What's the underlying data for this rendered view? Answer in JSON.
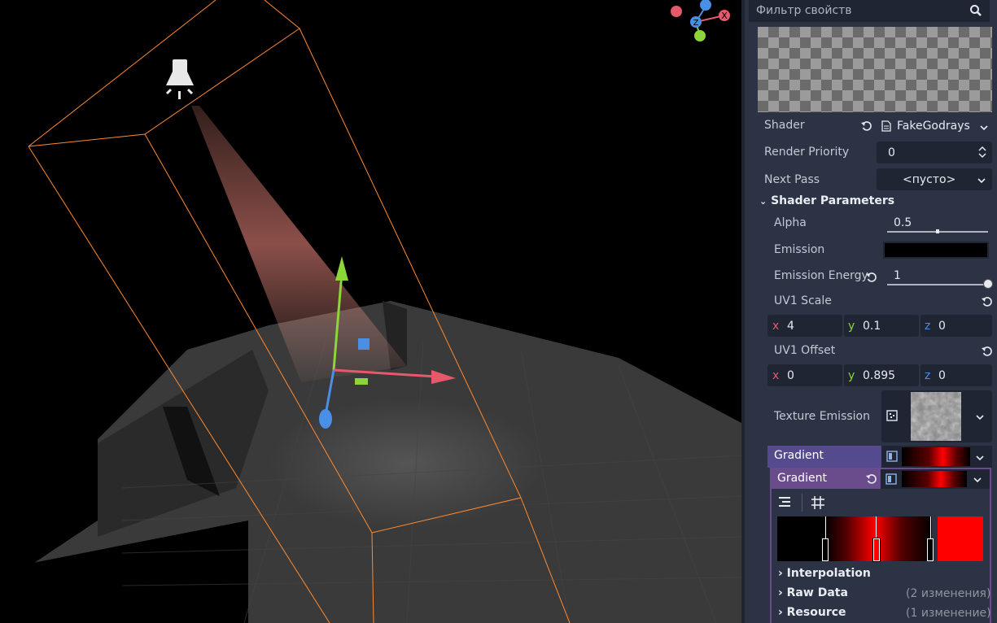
{
  "filter": {
    "placeholder": "Фильтр свойств",
    "icon": "search-icon"
  },
  "gizmo": {
    "x": "X",
    "y": "Y",
    "z": "Z"
  },
  "props": {
    "shader_label": "Shader",
    "shader_value": "FakeGodrays",
    "render_priority_label": "Render Priority",
    "render_priority_value": "0",
    "next_pass_label": "Next Pass",
    "next_pass_value": "<пусто>"
  },
  "shader_params": {
    "header": "Shader Parameters",
    "alpha_label": "Alpha",
    "alpha_value": "0.5",
    "alpha_level": 0.5,
    "emission_label": "Emission",
    "emission_color": "#000000",
    "emission_energy_label": "Emission Energy",
    "emission_energy_value": "1",
    "emission_energy_level": 1.0,
    "uv1_scale_label": "UV1 Scale",
    "uv1_scale": {
      "x_label": "x",
      "x": "4",
      "y_label": "y",
      "y": "0.1",
      "z_label": "z",
      "z": "0"
    },
    "uv1_offset_label": "UV1 Offset",
    "uv1_offset": {
      "x_label": "x",
      "x": "0",
      "y_label": "y",
      "y": "0.895",
      "z_label": "z",
      "z": "0"
    },
    "texture_emission_label": "Texture Emission"
  },
  "gradient": {
    "outer_label": "Gradient",
    "inner_label": "Gradient",
    "interpolation_label": "Interpolation",
    "raw_data_label": "Raw Data",
    "raw_data_hint": "(2 изменения)",
    "resource_label": "Resource",
    "resource_hint": "(1 изменение)",
    "selected_color": "#ff0000"
  },
  "colors": {
    "panel_bg": "#2c3345",
    "field_bg": "#1f2533",
    "axis_x": "#e6596b",
    "axis_y": "#8dd63a",
    "axis_z": "#4a8fe6",
    "selection": "#ff8a30"
  }
}
